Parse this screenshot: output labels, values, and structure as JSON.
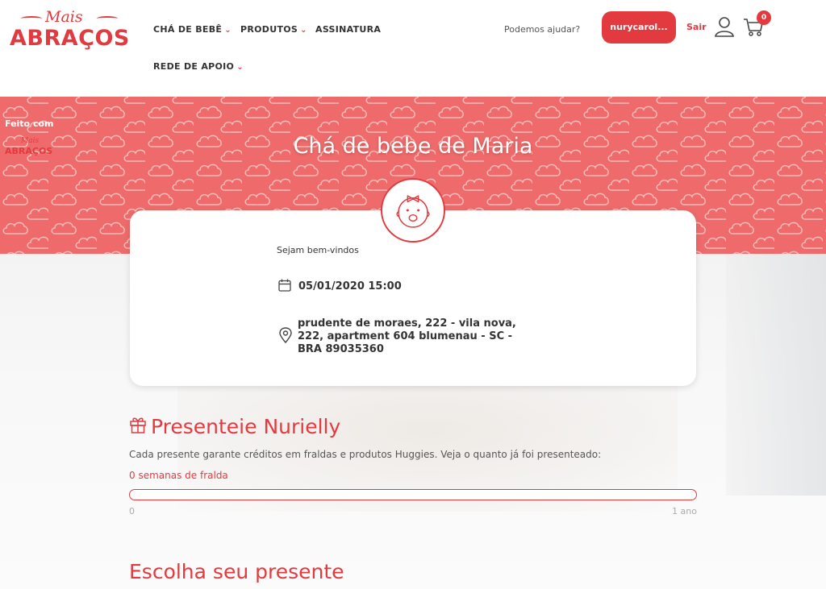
{
  "header": {
    "logo": {
      "top": "Mais",
      "bottom": "ABRAÇOS"
    },
    "nav": [
      {
        "label": "CHÁ DE BEBÊ",
        "has_dropdown": true
      },
      {
        "label": "PRODUTOS",
        "has_dropdown": true
      },
      {
        "label": "ASSINATURA",
        "has_dropdown": false
      },
      {
        "label": "REDE DE APOIO",
        "has_dropdown": true
      }
    ],
    "help_link": "Podemos ajudar?",
    "user_button": "nurycarol...",
    "logout": "Sair",
    "cart_count": "0"
  },
  "hero": {
    "made_with": "Feito com",
    "mini_logo_top": "Mais",
    "mini_logo_bottom": "ABRAÇOS",
    "title": "Chá de bebe de Maria",
    "background_color": "#ef6b6b"
  },
  "event": {
    "welcome": "Sejam bem-vindos",
    "datetime": "05/01/2020 15:00",
    "address": "prudente de moraes, 222 - vila nova, 222, apartment 604 blumenau - SC - BRA 89035360"
  },
  "gift": {
    "title": "Presenteie Nurielly",
    "description": "Cada presente garante créditos em fraldas e produtos Huggies. Veja o quanto já foi presenteado:",
    "weeks_label": "0 semanas de fralda",
    "progress_fraction": 0,
    "min_label": "0",
    "max_label": "1 ano"
  },
  "choose_title": "Escolha seu presente",
  "colors": {
    "accent": "#e23a3f"
  }
}
